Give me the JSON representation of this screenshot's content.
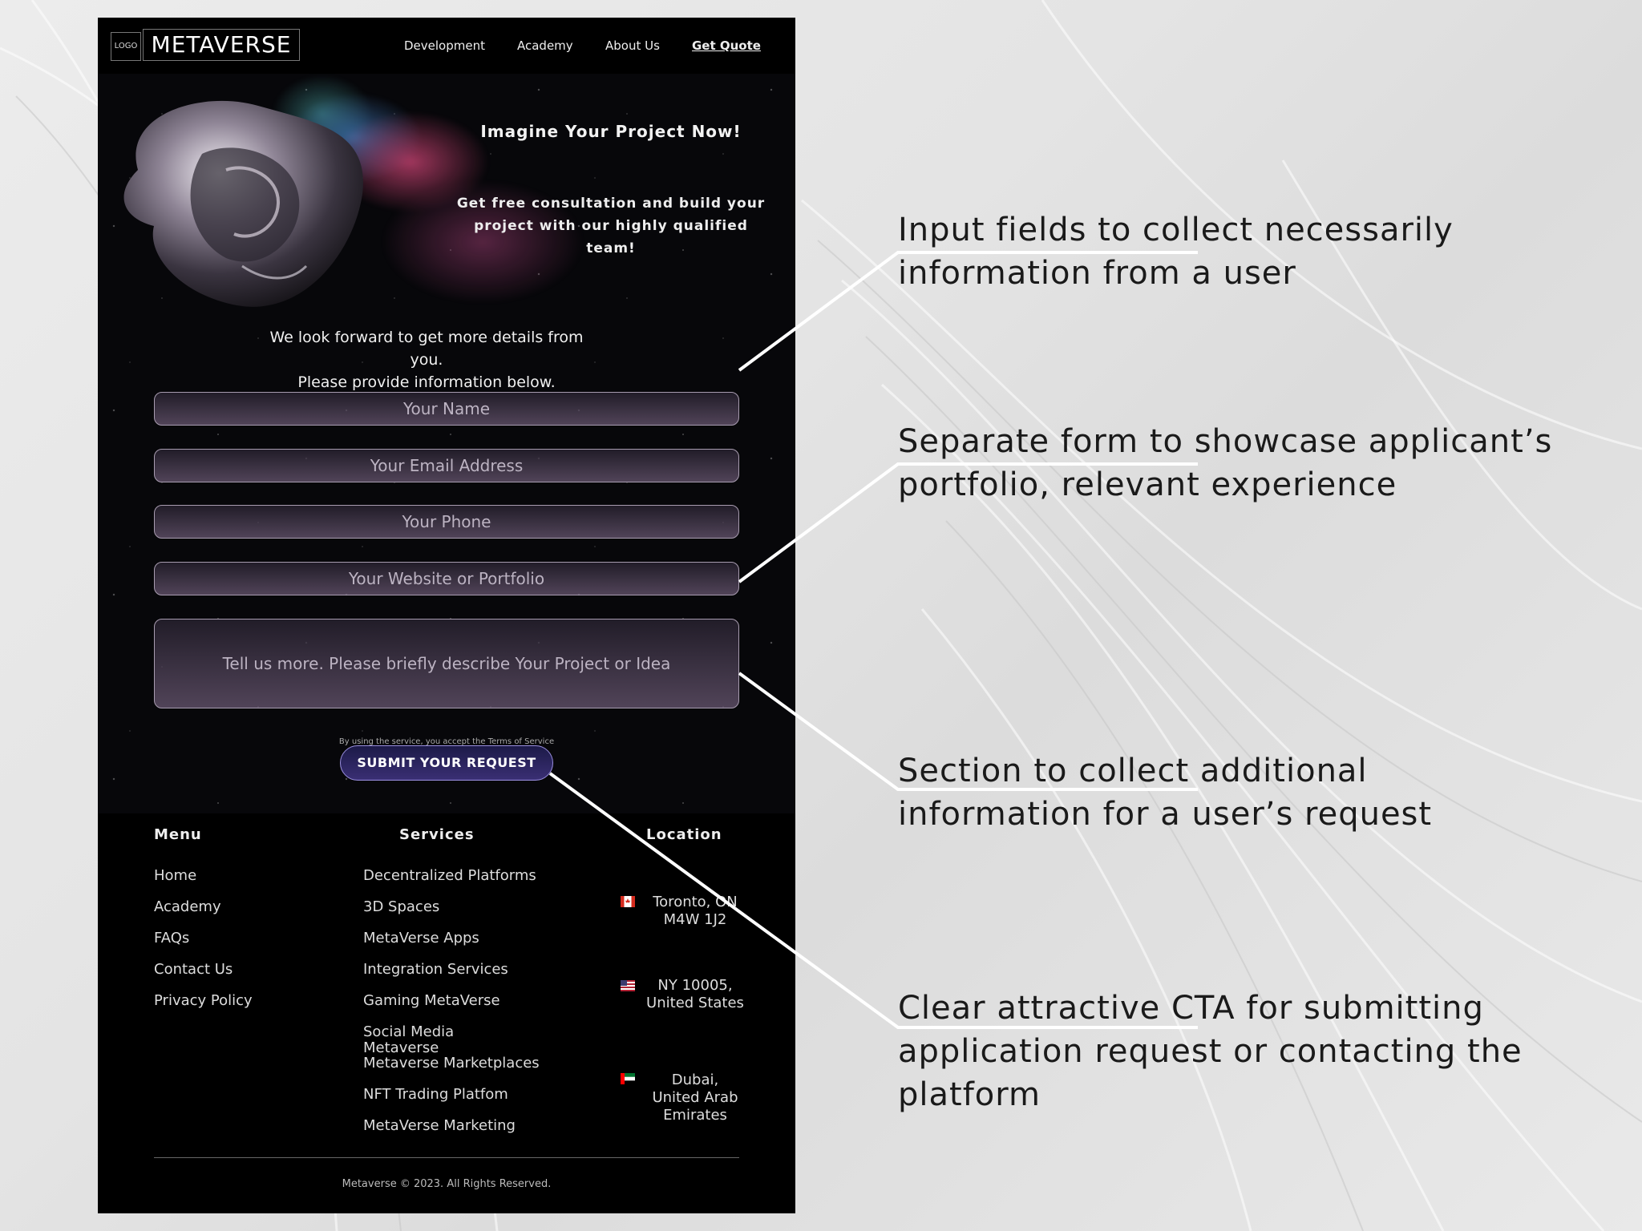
{
  "nav": {
    "logo_small": "LOGO",
    "logo_word": "METAVERSE",
    "links": [
      "Development",
      "Academy",
      "About Us",
      "Get Quote"
    ]
  },
  "hero": {
    "title": "Imagine Your Project Now!",
    "subtitle": "Get free consultation and build your project with our highly qualified team!"
  },
  "intro": {
    "line1": "We look forward to get more details from you.",
    "line2": "Please provide information below."
  },
  "form": {
    "name_placeholder": "Your Name",
    "email_placeholder": "Your Email Address",
    "phone_placeholder": "Your Phone",
    "website_placeholder": "Your Website or Portfolio",
    "message_placeholder": "Tell us more. Please briefly describe Your Project or Idea",
    "terms": "By using the service, you accept the Terms of Service",
    "submit_label": "SUBMIT YOUR REQUEST"
  },
  "footer": {
    "menu_heading": "Menu",
    "menu": [
      "Home",
      "Academy",
      "FAQs",
      "Contact Us",
      "Privacy Policy"
    ],
    "services_heading": "Services",
    "services": [
      "Decentralized Platforms",
      "3D Spaces",
      "MetaVerse Apps",
      "Integration Services",
      "Gaming MetaVerse",
      "Social Media",
      "Metaverse",
      "Metaverse Marketplaces",
      "NFT Trading Platfom",
      "MetaVerse Marketing"
    ],
    "location_heading": "Location",
    "locations": [
      {
        "line1": "Toronto, ON",
        "line2": "M4W 1J2",
        "line3": "",
        "flag": "canada-flag"
      },
      {
        "line1": "NY 10005,",
        "line2": "United States",
        "line3": "",
        "flag": "usa-flag"
      },
      {
        "line1": "Dubai,",
        "line2": "United Arab",
        "line3": "Emirates",
        "flag": "uae-flag"
      }
    ],
    "copyright": "Metaverse © 2023. All Rights Reserved."
  },
  "annotations": [
    {
      "line1": "Input fields to collect necessarily",
      "line2": "information from a user",
      "line3": ""
    },
    {
      "line1": "Separate form to showcase applicant’s",
      "line2": "portfolio, relevant experience",
      "line3": ""
    },
    {
      "line1": "Section to collect additional",
      "line2": "information for a user’s request",
      "line3": ""
    },
    {
      "line1": "Clear attractive CTA for submitting",
      "line2": "application request or contacting the",
      "line3": "platform"
    }
  ],
  "colors": {
    "page_bg": "#e6e6e6",
    "mock_bg": "#07070a",
    "field_border": "#a89cb0",
    "cta_border": "#9a8fe0",
    "annotation_text": "#1a1a1a"
  }
}
